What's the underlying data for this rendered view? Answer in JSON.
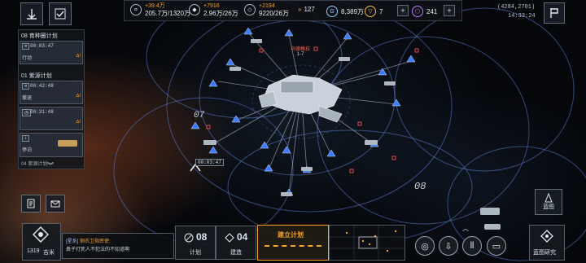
{
  "top_bar": {
    "resources": [
      {
        "icon": "credit-icon",
        "gain": "+39.4万",
        "amount": "205.7万/1320万"
      },
      {
        "icon": "metal-icon",
        "gain": "+7916",
        "amount": "2.96万/26万"
      },
      {
        "icon": "crystal-icon",
        "gain": "+2194",
        "amount": "9220/26万"
      }
    ],
    "fuel": "127",
    "premium_currency": "8,389万",
    "tokens": "7",
    "add_label": "+",
    "gems": "241",
    "coordinates": "(4284,2701)",
    "clock": "14:33:24"
  },
  "plans_panel": {
    "group1": {
      "title": "08 育种圈计划",
      "timer": "00:03:47",
      "status": "行动",
      "hazard": "∆!"
    },
    "group2": {
      "title": "01 紫源计划",
      "timer": "00:42:48",
      "status": "撤退",
      "hazard": "∆!"
    },
    "card3": {
      "timer": "00:31:48",
      "hazard": "∆!"
    },
    "card4": {
      "status": "停泊"
    },
    "footer": "04 紫源计划"
  },
  "map": {
    "sector_label_a": "07",
    "sector_label_b": "08",
    "station_name": "乌德格拉",
    "station_sub": "1-7",
    "fleet_timer": "00:03:47"
  },
  "bottom_bar": {
    "chat_channel": "[星系]",
    "chat_sender": "铜衣卫指挥使:",
    "chat_message": "鼻子打死人不犯法的不知道啊",
    "player_level": "1319",
    "player_name": "吉米",
    "plan_count": "08",
    "plan_label": "计划",
    "build_count": "04",
    "build_label": "建造",
    "build_plan_title": "建立计划",
    "blueprint_label": "蓝图",
    "blueprint_research_label": "蓝图研究"
  },
  "colors": {
    "accent": "#f4a22b",
    "hostile": "#e04848",
    "friendly": "#3a7bff",
    "panel": "#1a1f27"
  }
}
